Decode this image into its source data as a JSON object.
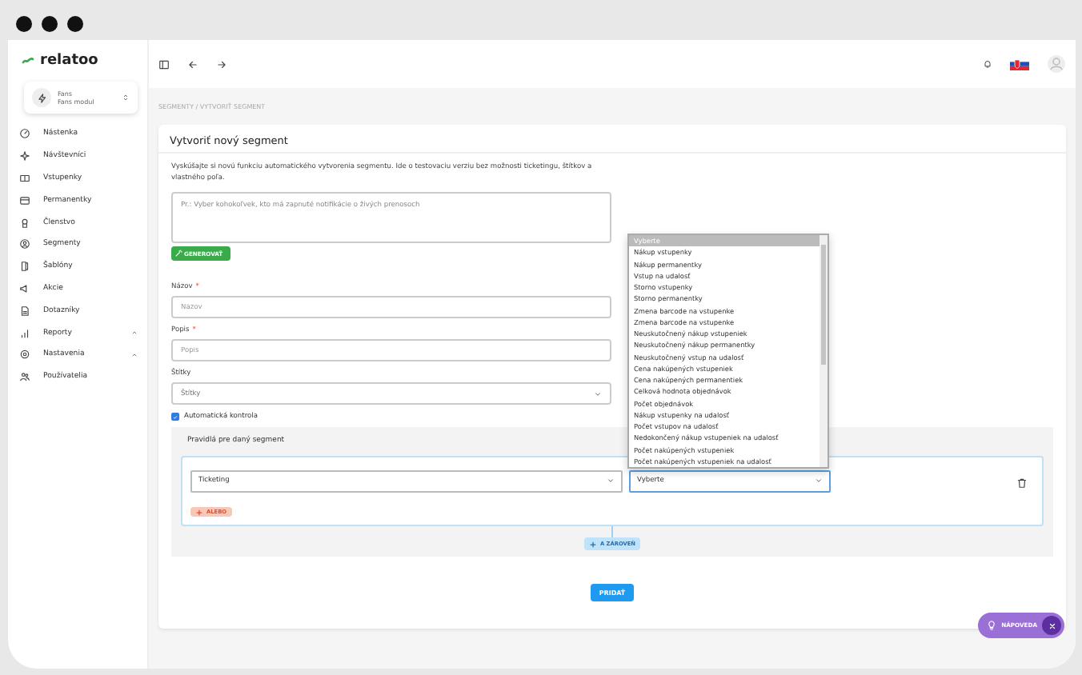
{
  "brand": {
    "name": "relatoo"
  },
  "module_switcher": {
    "title": "Fans",
    "subtitle": "Fans modul"
  },
  "sidebar": {
    "items": [
      {
        "label": "Nástenka",
        "kind": "link"
      },
      {
        "label": "Návštevníci",
        "kind": "link"
      },
      {
        "label": "Vstupenky",
        "kind": "link"
      },
      {
        "label": "Permanentky",
        "kind": "link"
      },
      {
        "label": "Členstvo",
        "kind": "link"
      },
      {
        "label": "Segmenty",
        "kind": "link"
      },
      {
        "label": "Šablóny",
        "kind": "link"
      },
      {
        "label": "Akcie",
        "kind": "link"
      },
      {
        "label": "Dotazníky",
        "kind": "link"
      },
      {
        "label": "Reporty",
        "kind": "group"
      },
      {
        "label": "Nastavenia",
        "kind": "group"
      },
      {
        "label": "Používatelia",
        "kind": "link"
      }
    ]
  },
  "breadcrumb": "SEGMENTY / VYTVORIŤ SEGMENT",
  "form": {
    "title": "Vytvoriť nový segment",
    "description": "Vyskúšajte si novú funkciu automatického vytvorenia segmentu. Ide o testovaciu verziu bez možnosti ticketingu, štítkov a vlastného poľa.",
    "prompt_placeholder": "Pr.: Vyber kohokoľvek, kto má zapnuté notifikácie o živých prenosoch",
    "generate_button": "GENEROVAŤ",
    "fields": [
      {
        "label": "Názov",
        "required_mark": "*",
        "placeholder": "Názov",
        "kind": "text"
      },
      {
        "label": "Popis",
        "required_mark": "*",
        "placeholder": "Popis",
        "kind": "text"
      },
      {
        "label": "Štítky",
        "placeholder": "Štítky",
        "kind": "select"
      }
    ],
    "auto_check": {
      "label": "Automatická kontrola",
      "checked": true
    },
    "rules": {
      "title": "Pravidlá pre daný segment",
      "category": "Ticketing",
      "condition": "Vyberte",
      "or_button": "ALEBO",
      "and_button": "A ZÁROVEŇ",
      "options": [
        {
          "label": "Vyberte",
          "selected": true
        },
        {
          "label": "Nákup vstupenky",
          "selected": false
        },
        {
          "label": "Nákup permanentky",
          "selected": false
        },
        {
          "label": "Vstup na udalosť",
          "selected": false
        },
        {
          "label": "Storno vstupenky",
          "selected": false
        },
        {
          "label": "Storno permanentky",
          "selected": false
        },
        {
          "label": "Zmena barcode na vstupenke",
          "selected": false
        },
        {
          "label": "Zmena barcode na vstupenke",
          "selected": false
        },
        {
          "label": "Neuskutočnený nákup vstupeniek",
          "selected": false
        },
        {
          "label": "Neuskutočnený nákup permanentky",
          "selected": false
        },
        {
          "label": "Neuskutočnený vstup na udalosť",
          "selected": false
        },
        {
          "label": "Cena nakúpených vstupeniek",
          "selected": false
        },
        {
          "label": "Cena nakúpených permanentiek",
          "selected": false
        },
        {
          "label": "Celková hodnota objednávok",
          "selected": false
        },
        {
          "label": "Počet objednávok",
          "selected": false
        },
        {
          "label": "Nákup vstupenky na udalosť",
          "selected": false
        },
        {
          "label": "Počet vstupov na udalosť",
          "selected": false
        },
        {
          "label": "Nedokončený nákup vstupeniek na udalosť",
          "selected": false
        },
        {
          "label": "Počet nakúpených vstupeniek",
          "selected": false
        },
        {
          "label": "Počet nakúpených vstupeniek na udalosť",
          "selected": false
        }
      ]
    },
    "submit_button": "PRIDAŤ"
  },
  "help_button": {
    "label": "NÁPOVEDA"
  }
}
